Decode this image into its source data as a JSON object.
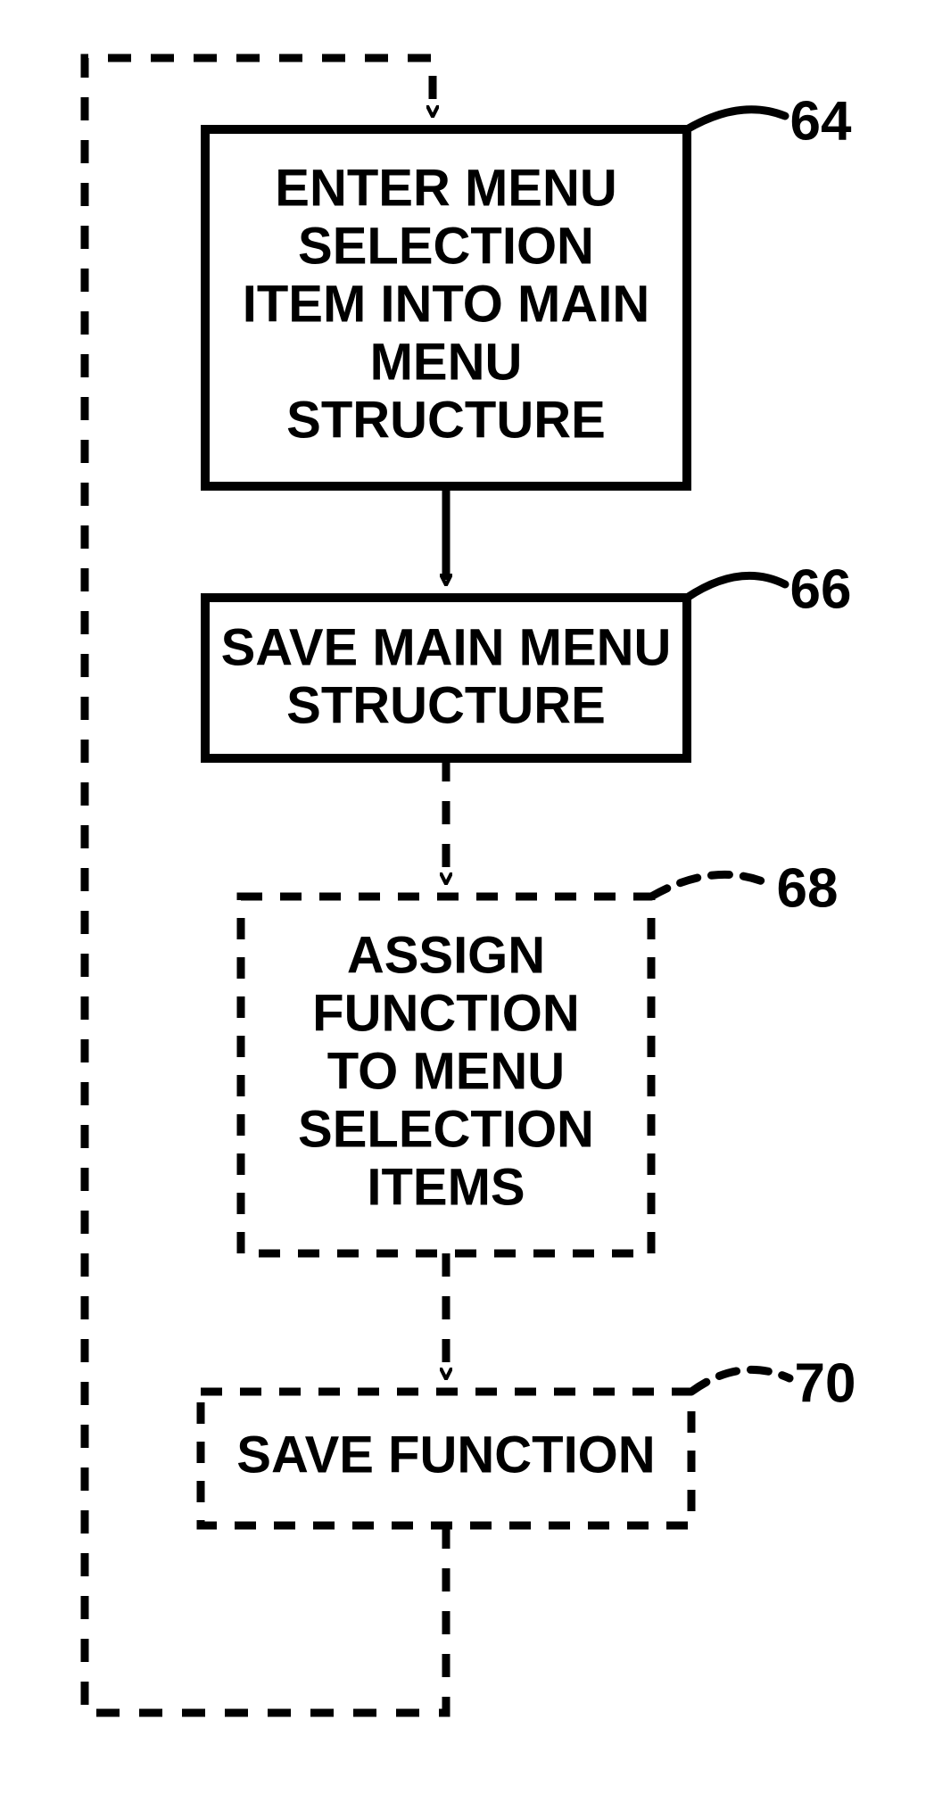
{
  "flow": {
    "nodes": {
      "n64": {
        "ref": "64",
        "lines": [
          "ENTER MENU",
          "SELECTION",
          "ITEM INTO MAIN",
          "MENU",
          "STRUCTURE"
        ]
      },
      "n66": {
        "ref": "66",
        "lines": [
          "SAVE MAIN MENU",
          "STRUCTURE"
        ]
      },
      "n68": {
        "ref": "68",
        "lines": [
          "ASSIGN",
          "FUNCTION",
          "TO MENU",
          "SELECTION",
          "ITEMS"
        ]
      },
      "n70": {
        "ref": "70",
        "lines": [
          "SAVE FUNCTION"
        ]
      }
    }
  },
  "chart_data": {
    "type": "flowchart",
    "nodes": [
      {
        "id": "64",
        "label": "ENTER MENU SELECTION ITEM INTO MAIN MENU STRUCTURE",
        "border": "solid"
      },
      {
        "id": "66",
        "label": "SAVE MAIN MENU STRUCTURE",
        "border": "solid"
      },
      {
        "id": "68",
        "label": "ASSIGN FUNCTION TO MENU SELECTION ITEMS",
        "border": "dashed"
      },
      {
        "id": "70",
        "label": "SAVE FUNCTION",
        "border": "dashed"
      }
    ],
    "edges": [
      {
        "from": "entry_top",
        "to": "64",
        "style": "dashed"
      },
      {
        "from": "64",
        "to": "66",
        "style": "solid"
      },
      {
        "from": "66",
        "to": "68",
        "style": "dashed"
      },
      {
        "from": "68",
        "to": "70",
        "style": "dashed"
      },
      {
        "from": "70",
        "to": "exit_bottom",
        "style": "dashed"
      },
      {
        "from": "exit_bottom",
        "to": "entry_top",
        "style": "dashed",
        "note": "feedback loop along left side"
      }
    ]
  }
}
